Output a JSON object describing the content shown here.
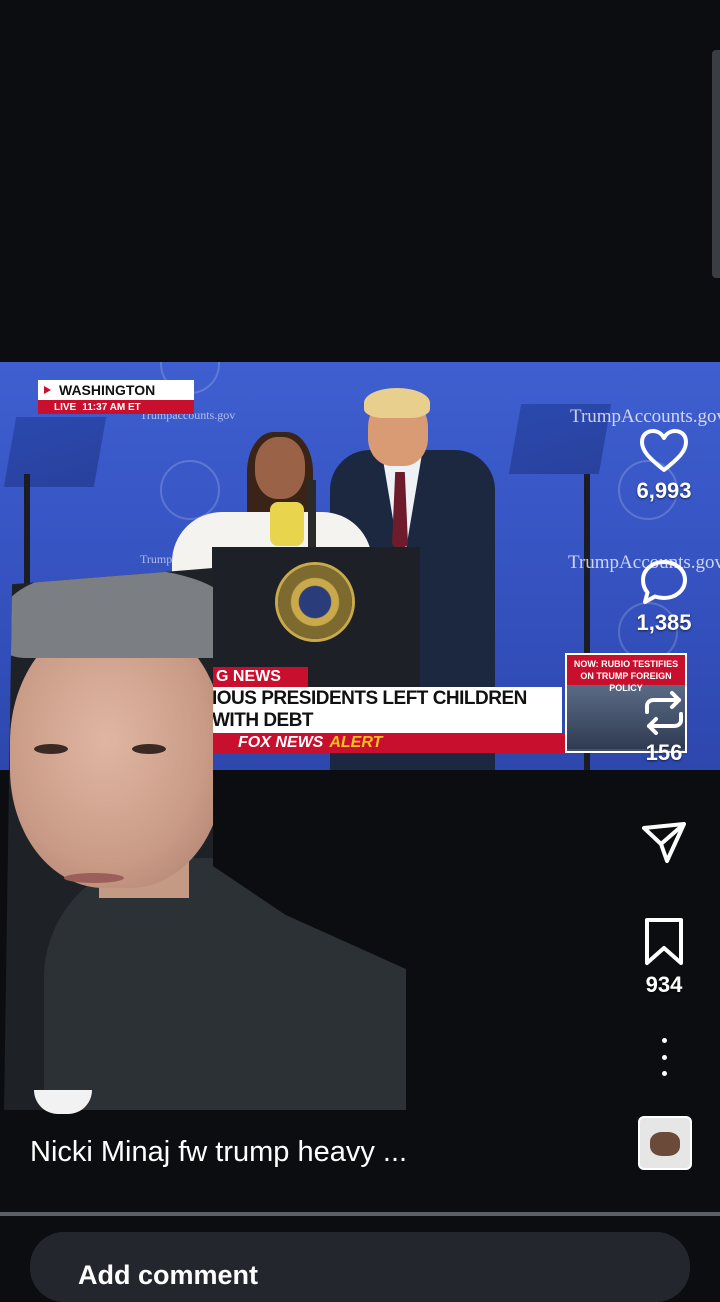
{
  "broadcast": {
    "location": "WASHINGTON",
    "live_label": "LIVE",
    "time": "11:37 AM ET",
    "watermark": "TrumpAccounts.gov",
    "watermark_partial_left": "Trumpaccounts.gov",
    "watermark_partial_mid": "TrumpA",
    "breaking_tab": "G NEWS",
    "headline": "IOUS PRESIDENTS LEFT CHILDREN WITH DEBT",
    "alert_prefix": "FOX NEWS",
    "alert_word": "ALERT",
    "inset_title": "NOW: RUBIO TESTIFIES ON TRUMP FOREIGN POLICY"
  },
  "actions": {
    "likes": "6,993",
    "comments": "1,385",
    "reposts": "156",
    "saves": "934"
  },
  "post": {
    "caption": "Nicki Minaj fw trump heavy ..."
  },
  "comment_input": {
    "placeholder": "Add comment"
  },
  "icons": {
    "like": "heart-icon",
    "comment": "comment-bubble-icon",
    "repost": "repost-icon",
    "share": "send-icon",
    "save": "bookmark-icon",
    "more": "more-vertical-icon"
  },
  "colors": {
    "background": "#0b0d11",
    "fox_red": "#c8102e",
    "alert_yellow": "#f4c21b",
    "stage_blue": "#3552c0"
  }
}
